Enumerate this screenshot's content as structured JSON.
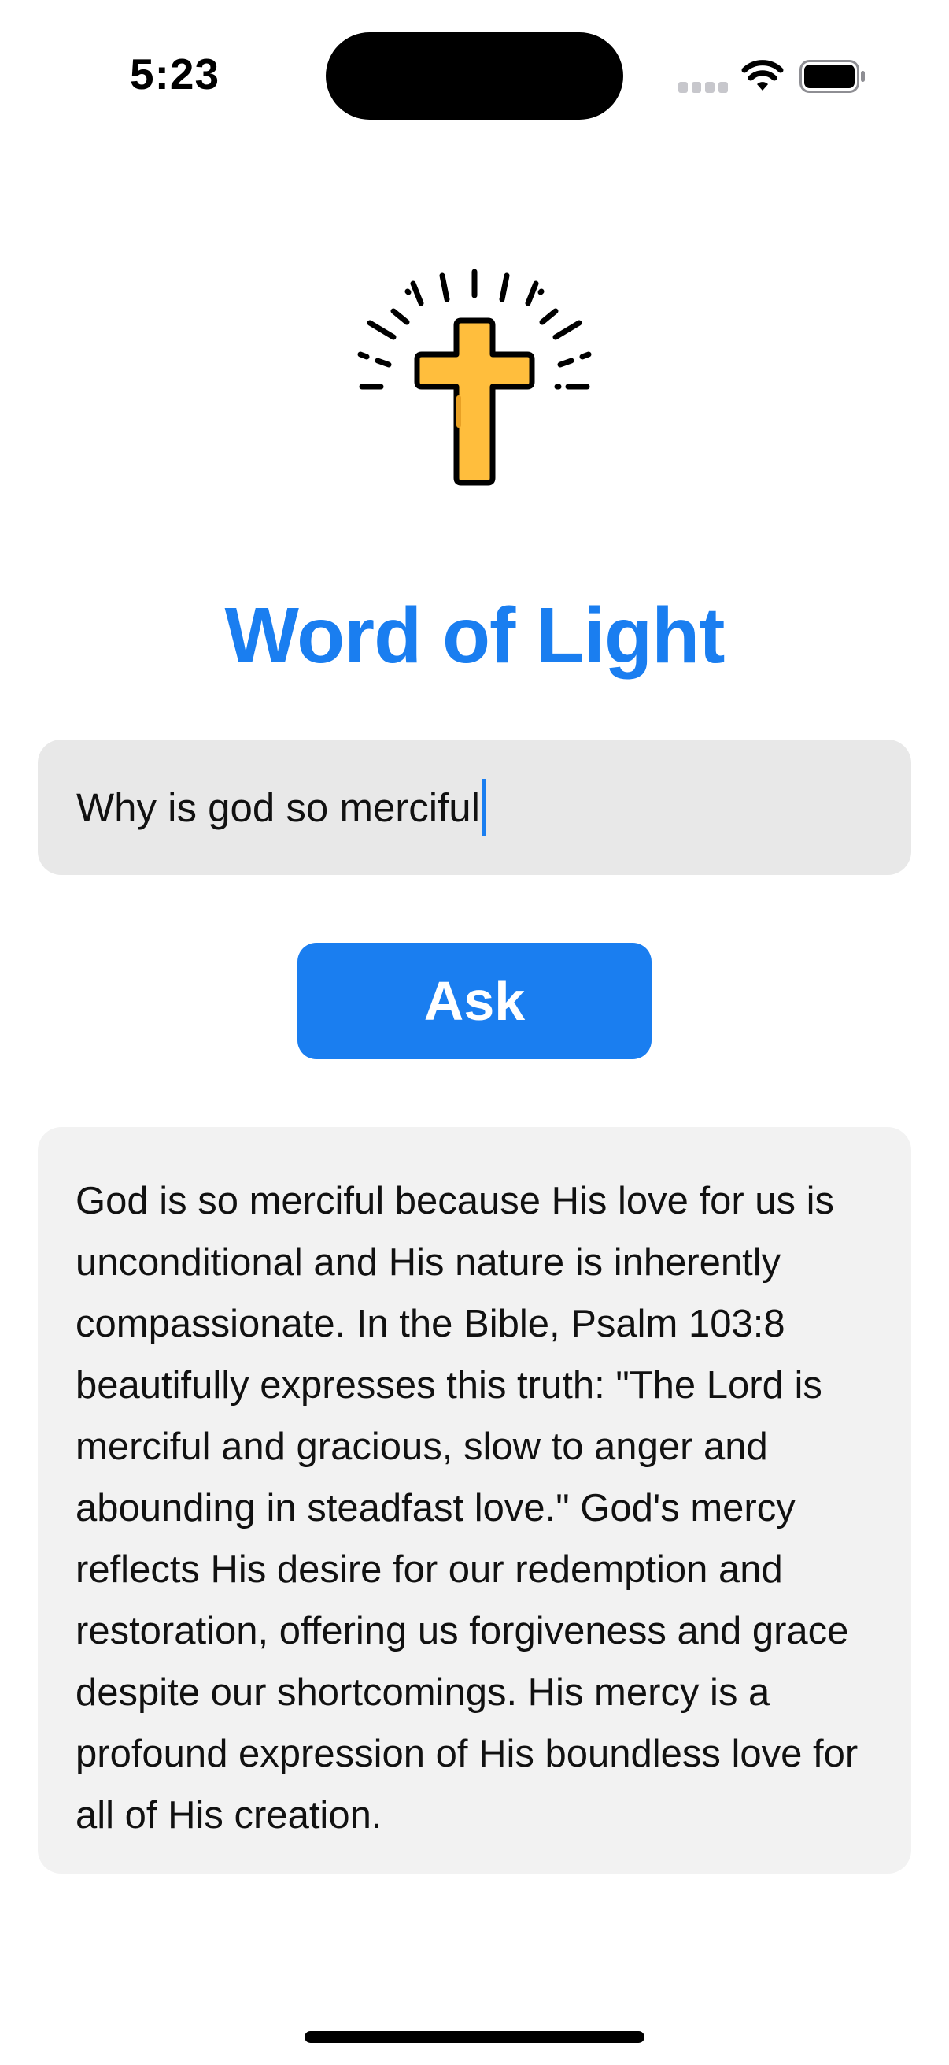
{
  "status_bar": {
    "time": "5:23",
    "icons": [
      "signal-icon",
      "wifi-icon",
      "battery-icon"
    ]
  },
  "app": {
    "logo_icon": "cross-icon",
    "title": "Word of Light"
  },
  "question": {
    "value": "Why is god so merciful"
  },
  "ask_button": {
    "label": "Ask"
  },
  "answer": {
    "text": "God is so merciful because His love for us is unconditional and His nature is inherently compassionate. In the Bible, Psalm 103:8 beautifully expresses this truth: \"The Lord is merciful and gracious, slow to anger and abounding in steadfast love.\" God's mercy reflects His desire for our redemption and restoration, offering us forgiveness and grace despite our shortcomings. His mercy is a profound expression of His boundless love for all of His creation."
  },
  "colors": {
    "accent": "#1a7ef0",
    "cross_fill": "#ffbe3d",
    "input_bg": "#e8e8e8",
    "card_bg": "#f2f2f2"
  }
}
